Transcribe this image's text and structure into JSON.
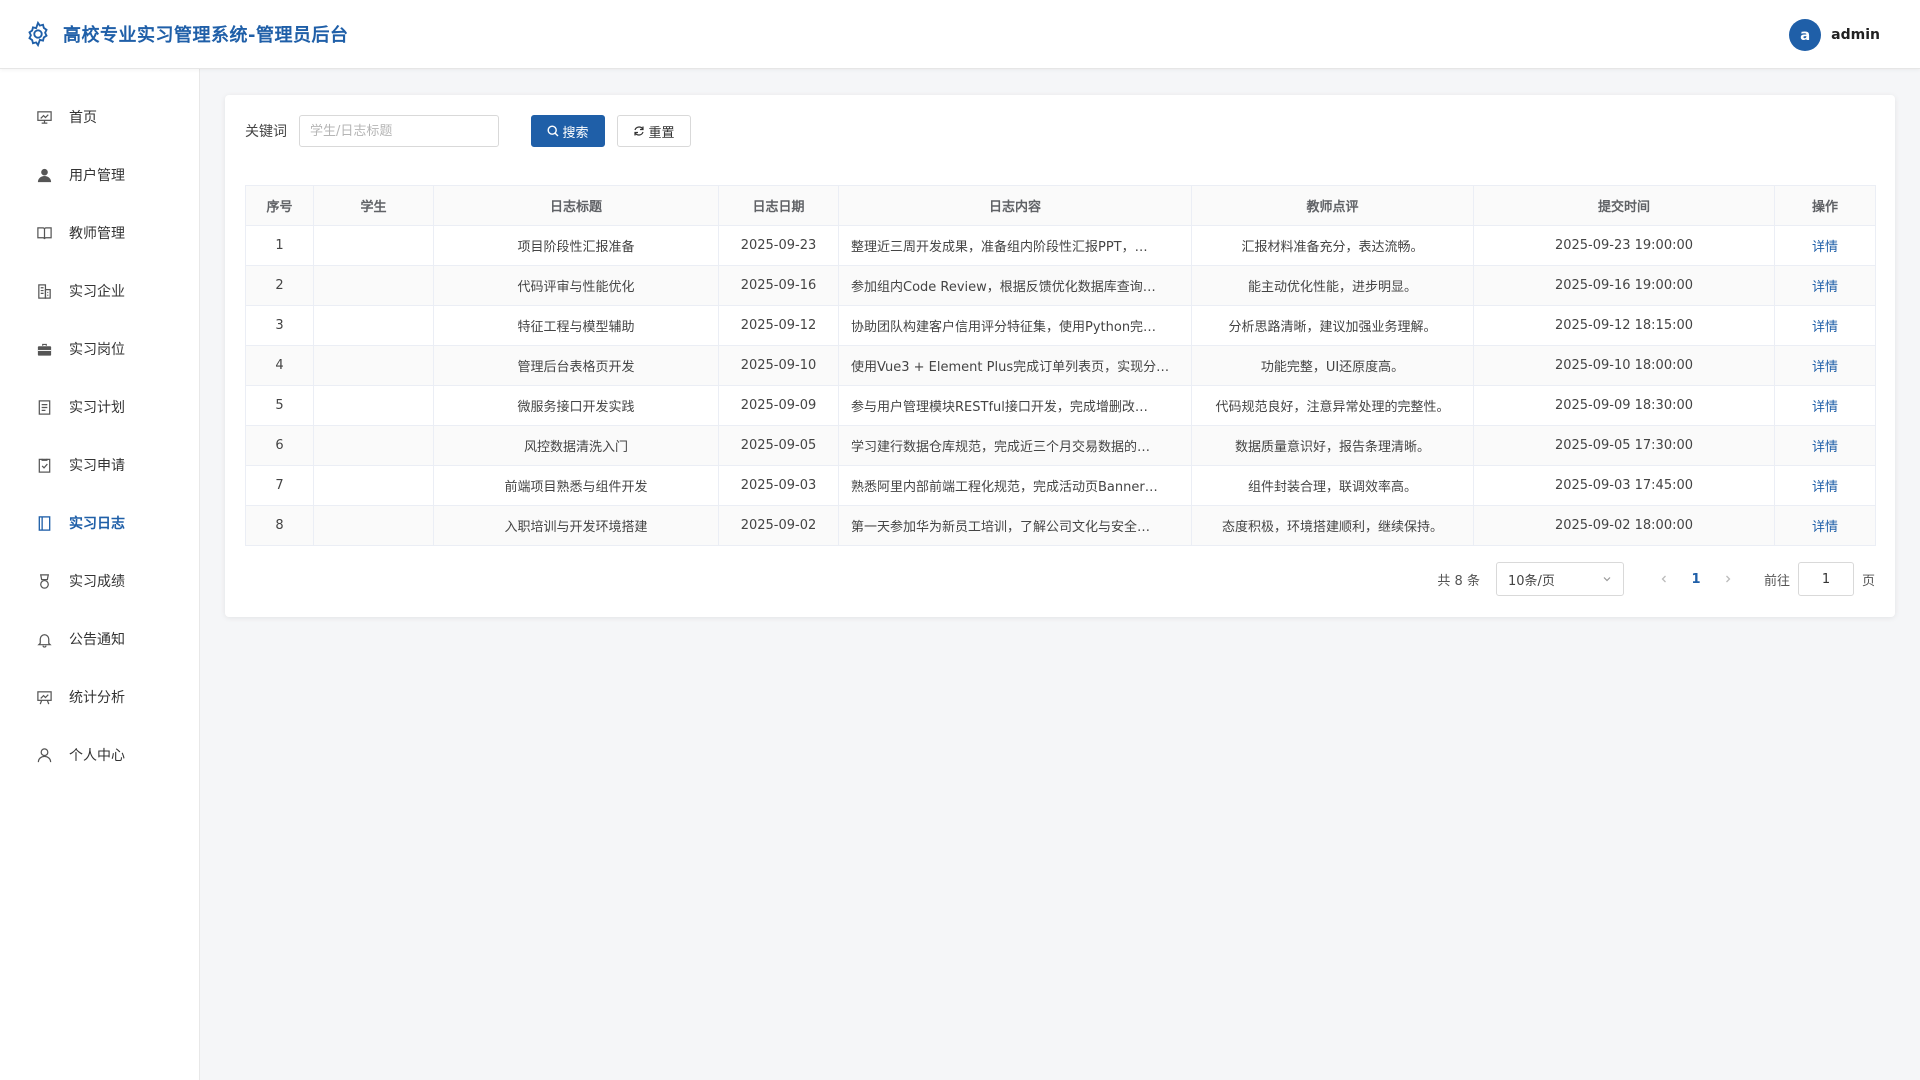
{
  "header": {
    "title": "高校专业实习管理系统-管理员后台",
    "avatar_letter": "a",
    "username": "admin"
  },
  "sidebar": {
    "items": [
      {
        "label": "首页",
        "icon": "dashboard-icon"
      },
      {
        "label": "用户管理",
        "icon": "user-icon"
      },
      {
        "label": "教师管理",
        "icon": "book-icon"
      },
      {
        "label": "实习企业",
        "icon": "building-icon"
      },
      {
        "label": "实习岗位",
        "icon": "briefcase-icon"
      },
      {
        "label": "实习计划",
        "icon": "document-icon"
      },
      {
        "label": "实习申请",
        "icon": "checklist-icon"
      },
      {
        "label": "实习日志",
        "icon": "notebook-icon",
        "active": true
      },
      {
        "label": "实习成绩",
        "icon": "medal-icon"
      },
      {
        "label": "公告通知",
        "icon": "bell-icon"
      },
      {
        "label": "统计分析",
        "icon": "presentation-icon"
      },
      {
        "label": "个人中心",
        "icon": "person-icon"
      }
    ]
  },
  "search": {
    "label": "关键词",
    "placeholder": "学生/日志标题",
    "value": "",
    "search_button": "搜索",
    "reset_button": "重置"
  },
  "table": {
    "columns": [
      "序号",
      "学生",
      "日志标题",
      "日志日期",
      "日志内容",
      "教师点评",
      "提交时间",
      "操作"
    ],
    "rows": [
      {
        "index": "1",
        "student": "",
        "title": "项目阶段性汇报准备",
        "date": "2025-09-23",
        "content": "整理近三周开发成果，准备组内阶段性汇报PPT，…",
        "comment": "汇报材料准备充分，表达流畅。",
        "submitted": "2025-09-23 19:00:00",
        "action": "详情"
      },
      {
        "index": "2",
        "student": "",
        "title": "代码评审与性能优化",
        "date": "2025-09-16",
        "content": "参加组内Code Review，根据反馈优化数据库查询…",
        "comment": "能主动优化性能，进步明显。",
        "submitted": "2025-09-16 19:00:00",
        "action": "详情"
      },
      {
        "index": "3",
        "student": "",
        "title": "特征工程与模型辅助",
        "date": "2025-09-12",
        "content": "协助团队构建客户信用评分特征集，使用Python完…",
        "comment": "分析思路清晰，建议加强业务理解。",
        "submitted": "2025-09-12 18:15:00",
        "action": "详情"
      },
      {
        "index": "4",
        "student": "",
        "title": "管理后台表格页开发",
        "date": "2025-09-10",
        "content": "使用Vue3 + Element Plus完成订单列表页，实现分…",
        "comment": "功能完整，UI还原度高。",
        "submitted": "2025-09-10 18:00:00",
        "action": "详情"
      },
      {
        "index": "5",
        "student": "",
        "title": "微服务接口开发实践",
        "date": "2025-09-09",
        "content": "参与用户管理模块RESTful接口开发，完成增删改…",
        "comment": "代码规范良好，注意异常处理的完整性。",
        "submitted": "2025-09-09 18:30:00",
        "action": "详情"
      },
      {
        "index": "6",
        "student": "",
        "title": "风控数据清洗入门",
        "date": "2025-09-05",
        "content": "学习建行数据仓库规范，完成近三个月交易数据的…",
        "comment": "数据质量意识好，报告条理清晰。",
        "submitted": "2025-09-05 17:30:00",
        "action": "详情"
      },
      {
        "index": "7",
        "student": "",
        "title": "前端项目熟悉与组件开发",
        "date": "2025-09-03",
        "content": "熟悉阿里内部前端工程化规范，完成活动页Banner…",
        "comment": "组件封装合理，联调效率高。",
        "submitted": "2025-09-03 17:45:00",
        "action": "详情"
      },
      {
        "index": "8",
        "student": "",
        "title": "入职培训与开发环境搭建",
        "date": "2025-09-02",
        "content": "第一天参加华为新员工培训，了解公司文化与安全…",
        "comment": "态度积极，环境搭建顺利，继续保持。",
        "submitted": "2025-09-02 18:00:00",
        "action": "详情"
      }
    ]
  },
  "pagination": {
    "total_text": "共 8 条",
    "page_size": "10条/页",
    "current_page": "1",
    "goto_label": "前往",
    "goto_value": "1",
    "goto_suffix": "页"
  },
  "colors": {
    "brand": "#1f5fa8"
  }
}
